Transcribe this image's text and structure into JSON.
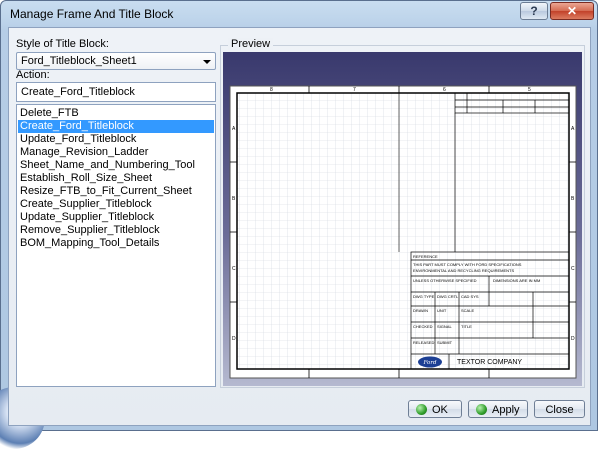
{
  "window": {
    "title": "Manage Frame And Title Block",
    "help_label": "?",
    "close_label": "✕"
  },
  "style_block": {
    "label": "Style of Title Block:",
    "selected": "Ford_Titleblock_Sheet1"
  },
  "action": {
    "label": "Action:",
    "current": "Create_Ford_Titleblock",
    "items": [
      "Delete_FTB",
      "Create_Ford_Titleblock",
      "Update_Ford_Titleblock",
      "Manage_Revision_Ladder",
      "Sheet_Name_and_Numbering_Tool",
      "Establish_Roll_Size_Sheet",
      "Resize_FTB_to_Fit_Current_Sheet",
      "Create_Supplier_Titleblock",
      "Update_Supplier_Titleblock",
      "Remove_Supplier_Titleblock",
      "BOM_Mapping_Tool_Details"
    ],
    "selected_index": 1
  },
  "preview": {
    "label": "Preview",
    "titleblock_company": "TEXTOR COMPANY",
    "titleblock_logo": "Ford",
    "titleblock_header": "REFERENCE"
  },
  "buttons": {
    "ok": "OK",
    "apply": "Apply",
    "close": "Close"
  }
}
